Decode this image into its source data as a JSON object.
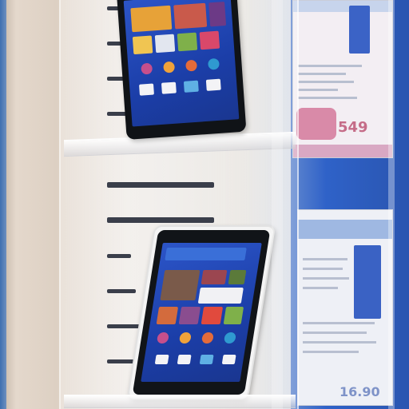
{
  "scene": {
    "description_key": "store-display",
    "colors": {
      "wall": "#e4d8cc",
      "stand": "#f2f2f2",
      "phone_body": "#101317",
      "screen_blue": "#2c55c8",
      "brochure_blue": "#2f62c8",
      "price_pink": "#c56c88"
    }
  },
  "top_brochure": {
    "price": "549"
  },
  "bottom_brochure": {
    "price": "16.90"
  }
}
